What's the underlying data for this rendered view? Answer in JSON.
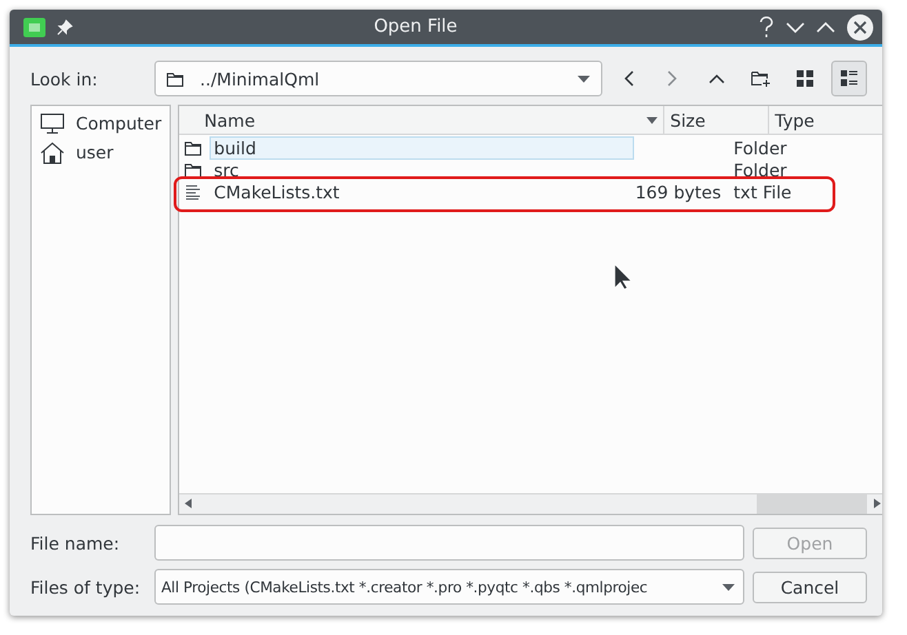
{
  "window": {
    "title": "Open File"
  },
  "look_in": {
    "label": "Look in:",
    "path": "../MinimalQml"
  },
  "places": [
    {
      "kind": "computer",
      "label": "Computer"
    },
    {
      "kind": "home",
      "label": "user"
    }
  ],
  "table": {
    "columns": [
      "Name",
      "Size",
      "Type"
    ],
    "rows": [
      {
        "kind": "folder",
        "name": "build",
        "size": "",
        "type": "Folder",
        "selected": true,
        "highlighted": false
      },
      {
        "kind": "folder",
        "name": "src",
        "size": "",
        "type": "Folder",
        "selected": false,
        "highlighted": false
      },
      {
        "kind": "text",
        "name": "CMakeLists.txt",
        "size": "169 bytes",
        "type": "txt File",
        "selected": false,
        "highlighted": true
      }
    ]
  },
  "file_name": {
    "label": "File name:"
  },
  "file_type": {
    "label": "Files of type:",
    "value": "All Projects (CMakeLists.txt *.creator *.pro *.pyqtc *.qbs *.qmlprojec"
  },
  "buttons": [
    {
      "label": "Open",
      "disabled": true
    },
    {
      "label": "Cancel",
      "disabled": false
    }
  ]
}
